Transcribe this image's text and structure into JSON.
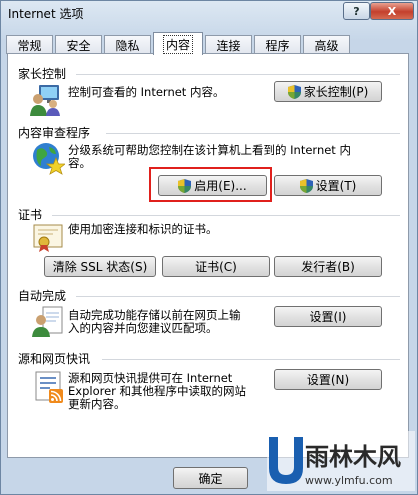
{
  "window": {
    "title": "Internet 选项",
    "help_label": "?",
    "close_label": "X"
  },
  "tabs": [
    {
      "label": "常规"
    },
    {
      "label": "安全"
    },
    {
      "label": "隐私"
    },
    {
      "label": "内容",
      "active": true
    },
    {
      "label": "连接"
    },
    {
      "label": "程序"
    },
    {
      "label": "高级"
    }
  ],
  "parental": {
    "title": "家长控制",
    "description": "控制可查看的 Internet 内容。",
    "button": "家长控制(P)",
    "icon": "users-monitor-icon"
  },
  "content_advisor": {
    "title": "内容审查程序",
    "description_line1": "分级系统可帮助您控制在该计算机上看到的 Internet 内",
    "description_line2": "容。",
    "enable_button": "启用(E)...",
    "settings_button": "设置(T)",
    "icon": "globe-star-icon"
  },
  "certificates": {
    "title": "证书",
    "description": "使用加密连接和标识的证书。",
    "clear_ssl_button": "清除 SSL 状态(S)",
    "certificates_button": "证书(C)",
    "publishers_button": "发行者(B)",
    "icon": "certificate-icon"
  },
  "autocomplete": {
    "title": "自动完成",
    "description_line1": "自动完成功能存储以前在网页上输",
    "description_line2": "入的内容并向您建议匹配项。",
    "settings_button": "设置(I)",
    "icon": "autocomplete-icon"
  },
  "feeds": {
    "title": "源和网页快讯",
    "description_line1": "源和网页快讯提供可在 Internet",
    "description_line2": "Explorer 和其他程序中读取的网站",
    "description_line3": "更新内容。",
    "settings_button": "设置(N)",
    "icon": "feeds-icon"
  },
  "footer": {
    "ok_button": "确定"
  },
  "watermark": {
    "text": "雨林木风",
    "url": "www.ylmfu.com"
  },
  "colors": {
    "highlight_box": "#e0201c",
    "close_button": "#c4402c"
  }
}
